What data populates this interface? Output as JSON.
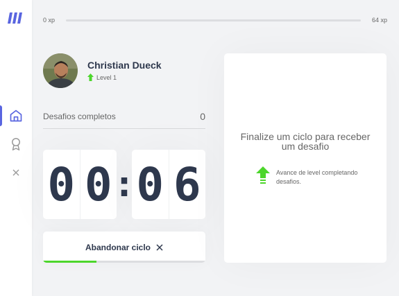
{
  "sidebar": {
    "logo_icon": "logo-icon",
    "items": [
      {
        "name": "home-icon",
        "active": true
      },
      {
        "name": "award-icon",
        "active": false
      },
      {
        "name": "close-icon",
        "active": false
      }
    ],
    "accent": "#5965e0"
  },
  "xp": {
    "min_label": "0 xp",
    "max_label": "64 xp",
    "progress": 0
  },
  "profile": {
    "name": "Christian Dueck",
    "level_label": "Level 1"
  },
  "challenges": {
    "label": "Desafios completos",
    "count": "0"
  },
  "countdown": {
    "minute_left": "0",
    "minute_right": "0",
    "separator": ":",
    "second_left": "0",
    "second_right": "6",
    "progress": 0.33
  },
  "abandon_button": {
    "label": "Abandonar ciclo",
    "icon": "close-icon"
  },
  "challenge_box": {
    "title": "Finalize um ciclo para receber um desafio",
    "hint": "Avance de level completando desafios.",
    "hint_icon": "level-up-icon"
  },
  "colors": {
    "green": "#4cd62b",
    "title": "#2e384d",
    "text": "#666666",
    "background": "#f2f3f5"
  }
}
